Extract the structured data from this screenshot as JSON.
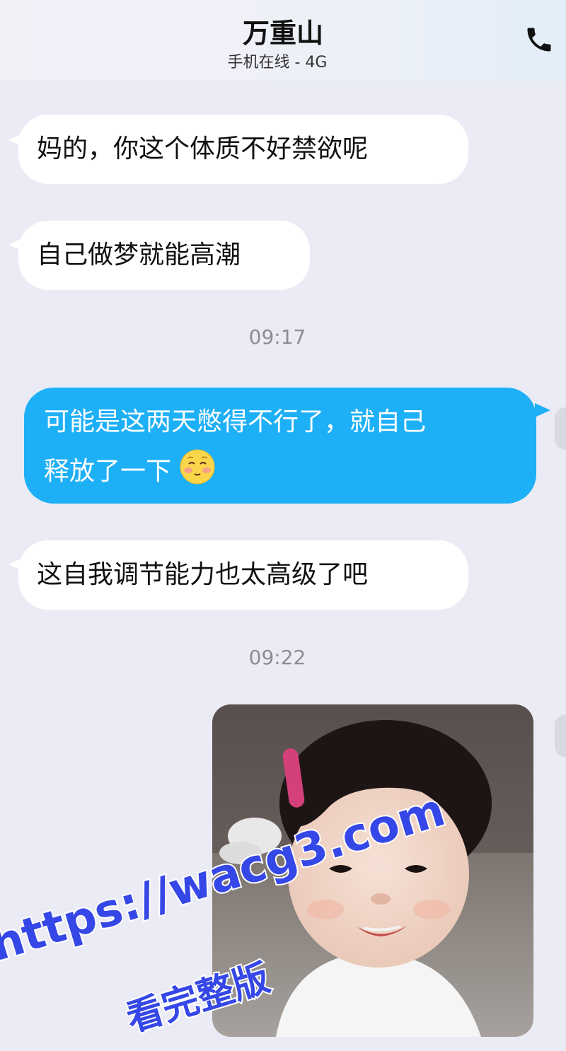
{
  "header": {
    "contact_name": "万重山",
    "status": "手机在线 - 4G",
    "call_icon": "phone-icon"
  },
  "messages": [
    {
      "side": "left",
      "text": "妈的，你这个体质不好禁欲呢"
    },
    {
      "side": "left",
      "text": "自己做梦就能高潮"
    },
    {
      "type": "timestamp",
      "text": "09:17"
    },
    {
      "side": "right",
      "text_line1": "可能是这两天憋得不行了，就自己",
      "text_line2": "释放了一下",
      "emoji": "blushing-face-emoji"
    },
    {
      "side": "left",
      "text": "这自我调节能力也太高级了吧"
    },
    {
      "type": "timestamp",
      "text": "09:22"
    },
    {
      "side": "right",
      "type": "image",
      "content": "photo of a smiling toddler with a pink hair clip"
    }
  ],
  "watermark": {
    "url": "https://wacg3.com",
    "subtitle": "看完整版"
  },
  "colors": {
    "background": "#ebebf5",
    "incoming_bubble": "#ffffff",
    "outgoing_bubble": "#1eb0f7",
    "timestamp": "#8c8c94",
    "watermark": "#3547e6"
  }
}
